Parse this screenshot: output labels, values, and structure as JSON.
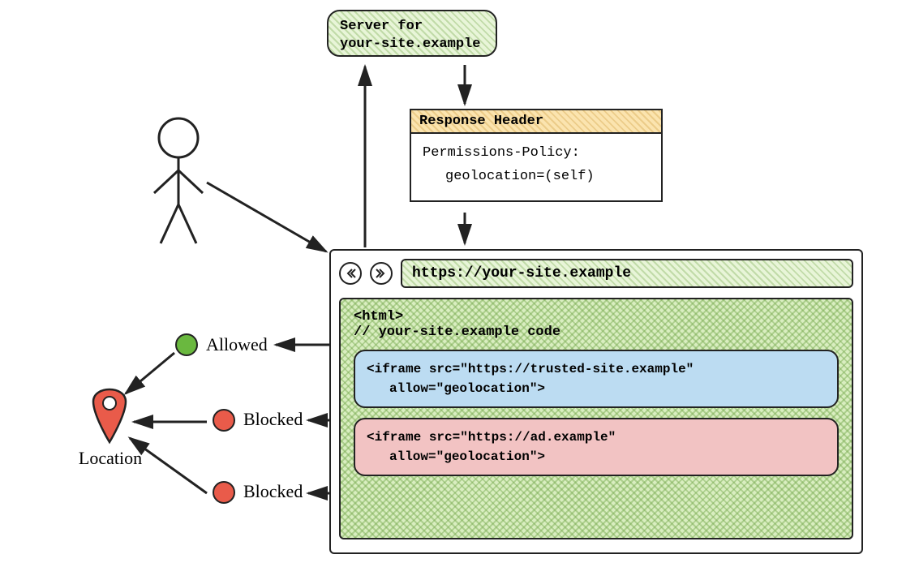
{
  "server": {
    "line1": "Server for",
    "line2": "your-site.example"
  },
  "response": {
    "title": "Response Header",
    "line1": "Permissions-Policy:",
    "line2": "geolocation=(self)"
  },
  "browser": {
    "url": "https://your-site.example",
    "code": {
      "line1": "<html>",
      "line2": "// your-site.example code"
    },
    "iframes": [
      {
        "src": "<iframe src=\"https://trusted-site.example\"",
        "allow": "allow=\"geolocation\">"
      },
      {
        "src": "<iframe src=\"https://ad.example\"",
        "allow": "allow=\"geolocation\">"
      }
    ]
  },
  "status": {
    "allowed": "Allowed",
    "blocked1": "Blocked",
    "blocked2": "Blocked"
  },
  "location_label": "Location"
}
